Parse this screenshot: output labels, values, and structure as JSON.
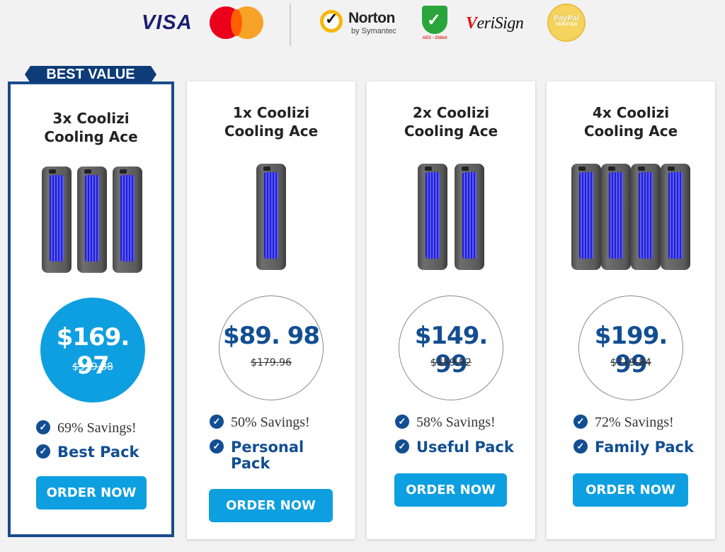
{
  "trust_bar": {
    "visa": "VISA",
    "norton_name": "Norton",
    "norton_sub": "by Symantec",
    "aes_label": "AES - 256bit",
    "verisign_v": "V",
    "verisign_rest": "eriSign",
    "paypal_name": "PayPal",
    "paypal_sub": "VERIFIED"
  },
  "colors": {
    "primary": "#0e9fe0",
    "navy": "#124e92",
    "featured_border": "#1a4a8c"
  },
  "ribbon": "BEST VALUE",
  "cards": [
    {
      "title_line1": "3x Coolizi",
      "title_line2": "Cooling Ace",
      "units": 3,
      "price": "$169. 97",
      "old_price": "$539.88",
      "savings": "69% Savings!",
      "pack": "Best Pack",
      "cta": "ORDER NOW"
    },
    {
      "title_line1": "1x Coolizi",
      "title_line2": "Cooling Ace",
      "units": 1,
      "price": "$89. 98",
      "old_price": "$179.96",
      "savings": "50% Savings!",
      "pack_line1": "Personal",
      "pack_line2": "Pack",
      "cta": "ORDER NOW"
    },
    {
      "title_line1": "2x Coolizi",
      "title_line2": "Cooling Ace",
      "units": 2,
      "price": "$149. 99",
      "old_price": "$359.92",
      "savings": "58% Savings!",
      "pack": "Useful Pack",
      "cta": "ORDER NOW"
    },
    {
      "title_line1": "4x Coolizi",
      "title_line2": "Cooling Ace",
      "units": 4,
      "price": "$199. 99",
      "old_price": "$719.84",
      "savings": "72% Savings!",
      "pack": "Family Pack",
      "cta": "ORDER NOW"
    }
  ]
}
